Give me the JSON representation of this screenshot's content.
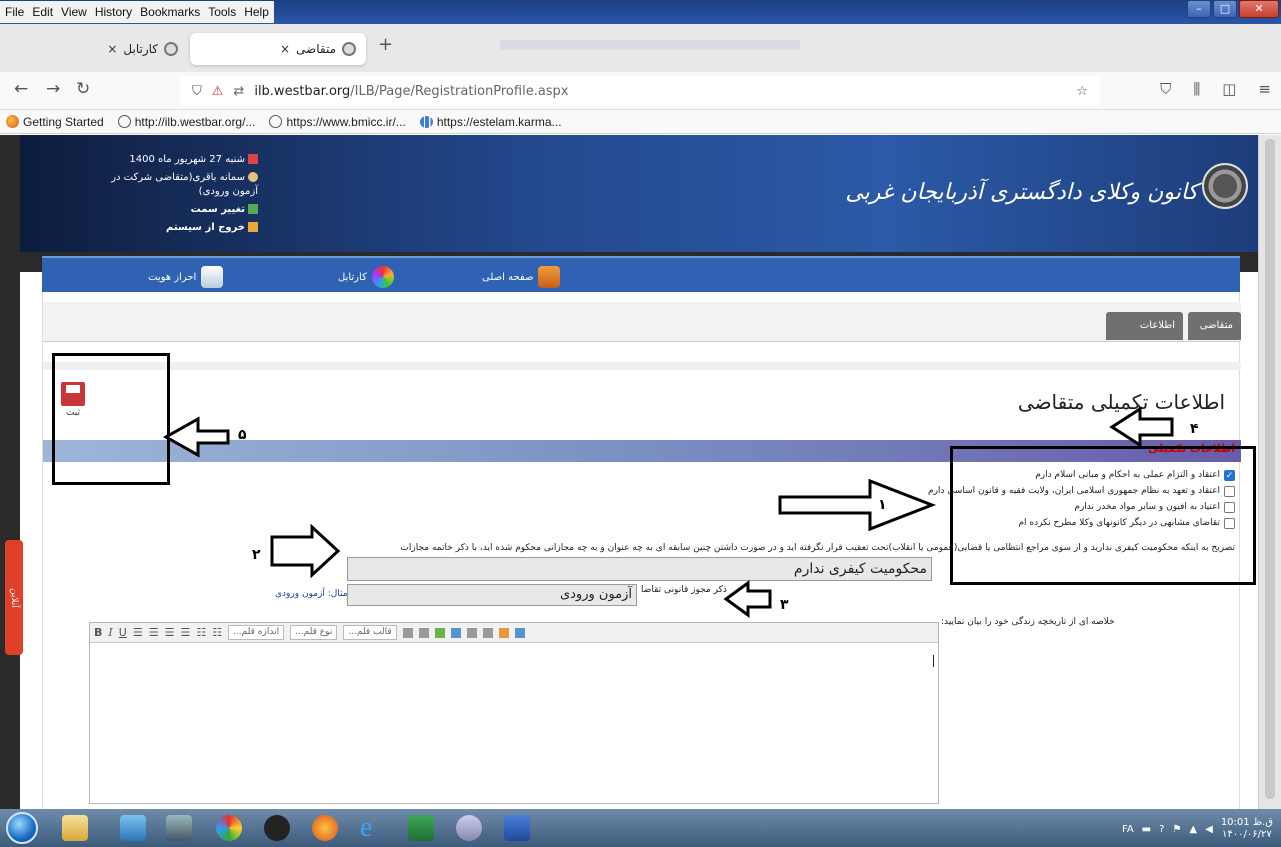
{
  "browser": {
    "menu": [
      "File",
      "Edit",
      "View",
      "History",
      "Bookmarks",
      "Tools",
      "Help"
    ],
    "tabs": [
      {
        "label": "کارتابل",
        "active": false
      },
      {
        "label": "متقاضی",
        "active": true
      }
    ],
    "url_host": "ilb.westbar.org",
    "url_path": "/ILB/Page/RegistrationProfile.aspx",
    "bookmarks": [
      "Getting Started",
      "http://ilb.westbar.org/...",
      "https://www.bmicc.ir/...",
      "https://estelam.karma..."
    ]
  },
  "header": {
    "date": "شنبه 27 شهریور ماه 1400",
    "user": "سمانه باقری(متقاضی شرکت در آزمون ورودی)",
    "change_role": "تغییر سمت",
    "logout": "خروج از سیستم",
    "org_name": "کانون وکلای دادگستری آذربایجان غربی"
  },
  "nav": {
    "home": "صفحه اصلی",
    "kartabl": "کارتابل",
    "identity": "احراز هویت"
  },
  "subtabs": {
    "applicant": "متقاضی",
    "additional_info": "اطلاعات تکمیلی"
  },
  "page": {
    "title": "اطلاعات تکمیلی متقاضی",
    "save_label": "ثبت",
    "section_title": "اطلاعات تکمیلی"
  },
  "checks": [
    {
      "label": "اعتقاد و التزام عملی به احکام و مبانی اسلام دارم",
      "checked": true
    },
    {
      "label": "اعتقاد و تعهد به نظام جمهوری اسلامی ایران، ولایت فقیه و قانون اساسی دارم",
      "checked": false
    },
    {
      "label": "اعتیاد به افیون و سایر مواد مخدر ندارم",
      "checked": false
    },
    {
      "label": "تقاضای مشابهی در دیگر کانونهای وکلا مطرح نکرده ام",
      "checked": false
    }
  ],
  "form": {
    "conviction_label": "تصریح به اینکه محکومیت کیفری ندارید و از سوی مراجع انتظامی یا قضایی(عمومی یا انقلاب)تحت تعقیب قرار نگرفته اید و در صورت داشتن چنین سابقه ای به چه عنوان و به چه مجازاتی محکوم شده اید، با ذکر خاتمه مجازات",
    "conviction_value": "محکومیت کیفری ندارم",
    "legal_label": "ذکر مجوز قانونی تقاضا",
    "legal_value": "آزمون ورودی",
    "legal_example": "مثال: آزمون ورودی",
    "bio_label": "خلاصه ای از تاریخچه زندگی خود را بیان نمایید:"
  },
  "editor": {
    "font_size": "اندازه قلم...",
    "font_type": "نوع قلم...",
    "format": "قالب قلم..."
  },
  "side_tab": "آنلاین",
  "annotations": [
    "۱",
    "۲",
    "۳",
    "۴",
    "۵"
  ],
  "taskbar": {
    "lang": "FA",
    "time": "10:01 ق.ظ",
    "date": "۱۴۰۰/۰۶/۲۷"
  },
  "colors": {
    "nav_blue": "#2f62b2",
    "header_dark": "#0e1d3d",
    "section_red": "#cc0000"
  }
}
